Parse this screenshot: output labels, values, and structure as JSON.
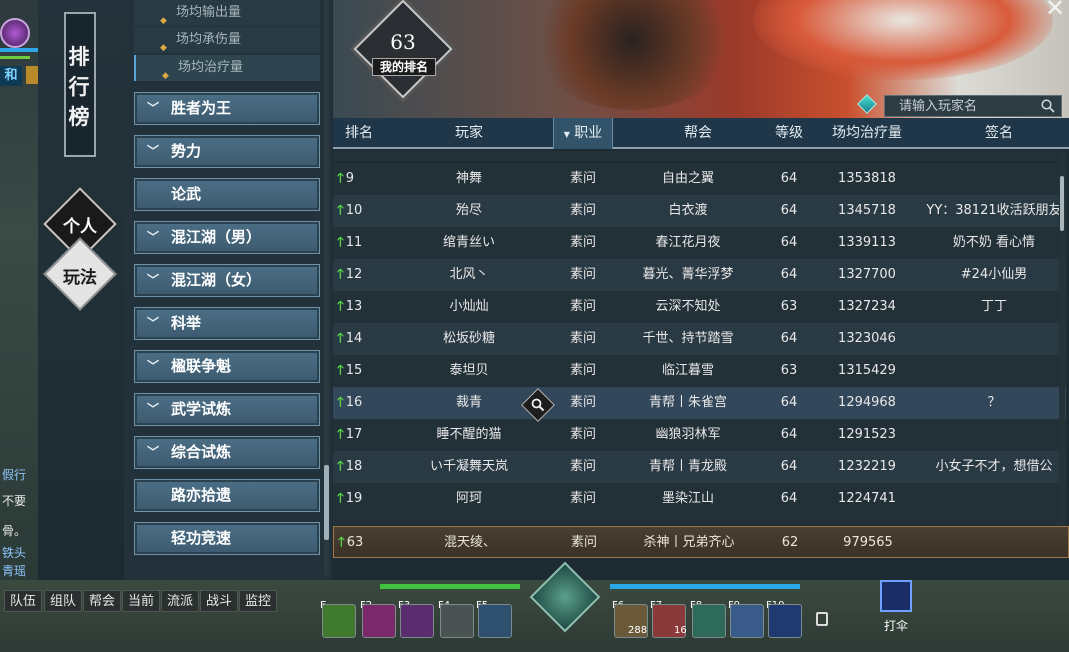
{
  "window": {
    "title": "排行榜",
    "close": "✕"
  },
  "left_hud": {
    "tag": "和",
    "side_texts": [
      "假行",
      "不要",
      "骨。",
      "铁头",
      "青瑶"
    ]
  },
  "modes": [
    {
      "label": "个人",
      "active": true
    },
    {
      "label": "玩法",
      "active": false
    }
  ],
  "sub_items": [
    {
      "label": "场均输出量",
      "active": false
    },
    {
      "label": "场均承伤量",
      "active": false
    },
    {
      "label": "场均治疗量",
      "active": true
    }
  ],
  "categories": [
    {
      "label": "胜者为王",
      "expandable": true
    },
    {
      "label": "势力",
      "expandable": true
    },
    {
      "label": "论武",
      "expandable": false
    },
    {
      "label": "混江湖（男）",
      "expandable": true
    },
    {
      "label": "混江湖（女）",
      "expandable": true
    },
    {
      "label": "科举",
      "expandable": true
    },
    {
      "label": "楹联争魁",
      "expandable": true
    },
    {
      "label": "武学试炼",
      "expandable": true
    },
    {
      "label": "综合试炼",
      "expandable": true
    },
    {
      "label": "路亦拾遗",
      "expandable": false
    },
    {
      "label": "轻功竞速",
      "expandable": false
    }
  ],
  "my_rank": {
    "value": "63",
    "label": "我的排名"
  },
  "search": {
    "placeholder": "请输入玩家名"
  },
  "columns": {
    "rank": "排名",
    "player": "玩家",
    "class": "职业",
    "guild": "帮会",
    "level": "等级",
    "value": "场均治疗量",
    "signature": "签名"
  },
  "rows": [
    {
      "rank": "9",
      "player": "神舞",
      "class": "素问",
      "guild": "自由之翼",
      "level": "64",
      "value": "1353818",
      "signature": ""
    },
    {
      "rank": "10",
      "player": "殆尽",
      "class": "素问",
      "guild": "白衣渡",
      "level": "64",
      "value": "1345718",
      "signature": "YY：38121收活跃朋友"
    },
    {
      "rank": "11",
      "player": "绾青丝い",
      "class": "素问",
      "guild": "春江花月夜",
      "level": "64",
      "value": "1339113",
      "signature": "奶不奶 看心情"
    },
    {
      "rank": "12",
      "player": "北风丶",
      "class": "素问",
      "guild": "暮光、菁华浮梦",
      "level": "64",
      "value": "1327700",
      "signature": "#24小仙男"
    },
    {
      "rank": "13",
      "player": "小灿灿",
      "class": "素问",
      "guild": "云深不知处",
      "level": "63",
      "value": "1327234",
      "signature": "丁丁"
    },
    {
      "rank": "14",
      "player": "松坂砂糖",
      "class": "素问",
      "guild": "千世、持节踏雪",
      "level": "64",
      "value": "1323046",
      "signature": ""
    },
    {
      "rank": "15",
      "player": "泰坦贝",
      "class": "素问",
      "guild": "临江暮雪",
      "level": "63",
      "value": "1315429",
      "signature": ""
    },
    {
      "rank": "16",
      "player": "裁青",
      "class": "素问",
      "guild": "青帮丨朱雀宫",
      "level": "64",
      "value": "1294968",
      "signature": "？"
    },
    {
      "rank": "17",
      "player": "睡不醒的猫",
      "class": "素问",
      "guild": "幽狼羽林军",
      "level": "64",
      "value": "1291523",
      "signature": ""
    },
    {
      "rank": "18",
      "player": "い千凝舞天岚",
      "class": "素问",
      "guild": "青帮丨青龙殿",
      "level": "64",
      "value": "1232219",
      "signature": "小女子不才，想借公"
    },
    {
      "rank": "19",
      "player": "阿珂",
      "class": "素问",
      "guild": "墨染江山",
      "level": "64",
      "value": "1224741",
      "signature": ""
    }
  ],
  "my_row": {
    "rank": "63",
    "player": "混天绫、",
    "class": "素问",
    "guild": "杀神丨兄弟齐心",
    "level": "62",
    "value": "979565",
    "signature": ""
  },
  "chat_channels": [
    "队伍",
    "组队",
    "帮会",
    "当前",
    "流派",
    "战斗",
    "监控"
  ],
  "skills": {
    "keys": [
      "E",
      "F2",
      "F3",
      "F4",
      "F5",
      "F6",
      "F7",
      "F8",
      "F9",
      "F10"
    ],
    "counts": {
      "f6": "288",
      "f7": "16"
    },
    "portrait_label": "打伞"
  },
  "colors": {
    "up_arrow": "#59d14a",
    "header_bg": "#1f3749",
    "category_btn": "#4c6f86",
    "highlight_row": "#a07a46"
  }
}
